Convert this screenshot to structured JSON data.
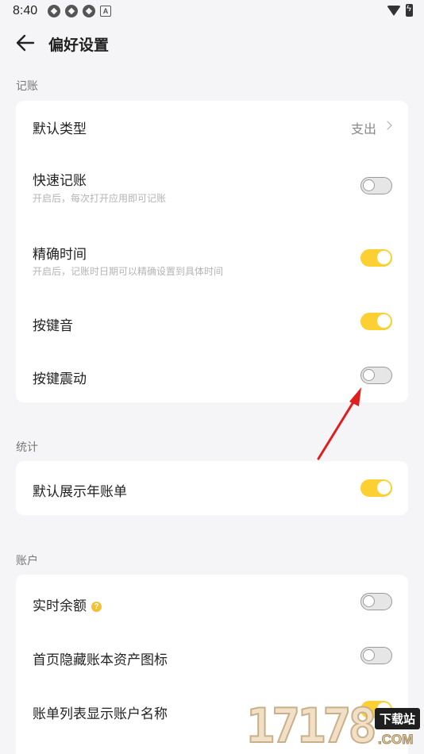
{
  "status_bar": {
    "time": "8:40",
    "badge_letter": "A"
  },
  "header": {
    "title": "偏好设置",
    "back_icon": "arrow-left-icon"
  },
  "sections": [
    {
      "label": "记账",
      "rows": [
        {
          "title": "默认类型",
          "value": "支出",
          "type": "link"
        },
        {
          "title": "快速记账",
          "subtitle": "开启后，每次打开应用即可记账",
          "toggle": false
        },
        {
          "title": "精确时间",
          "subtitle": "开启后，记账时日期可以精确设置到具体时间",
          "toggle": true
        },
        {
          "title": "按键音",
          "toggle": true
        },
        {
          "title": "按键震动",
          "toggle": false
        }
      ]
    },
    {
      "label": "统计",
      "rows": [
        {
          "title": "默认展示年账单",
          "toggle": true
        }
      ]
    },
    {
      "label": "账户",
      "rows": [
        {
          "title": "实时余额",
          "help_icon": "?",
          "toggle": false
        },
        {
          "title": "首页隐藏账本资产图标",
          "toggle": false
        },
        {
          "title": "账单列表显示账户名称",
          "toggle": true
        }
      ]
    }
  ],
  "colors": {
    "toggle_on": "#fcd033",
    "toggle_off": "#e6e6e6",
    "annotation_arrow": "#e01e1e",
    "background": "#f5f5f7"
  },
  "watermark": {
    "digits": "17178",
    "badge": "下载站",
    "domain": ".COM"
  }
}
